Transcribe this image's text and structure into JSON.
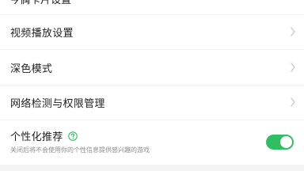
{
  "settings": {
    "partial_top_label": "今偶卡片设置",
    "items": [
      {
        "label": "视频播放设置"
      },
      {
        "label": "深色模式"
      },
      {
        "label": "网络检测与权限管理"
      }
    ],
    "recommendation": {
      "title": "个性化推荐",
      "description": "关闭后将不会使用你的个性信息提供感兴趣的游戏",
      "enabled": true
    }
  },
  "colors": {
    "accent": "#2fbf62",
    "text_primary": "#1f1f1f",
    "text_secondary": "#8c8c8c",
    "divider": "#f0f0f0"
  },
  "icons": {
    "chevron": "chevron-right-icon",
    "help": "help-circle-icon"
  }
}
